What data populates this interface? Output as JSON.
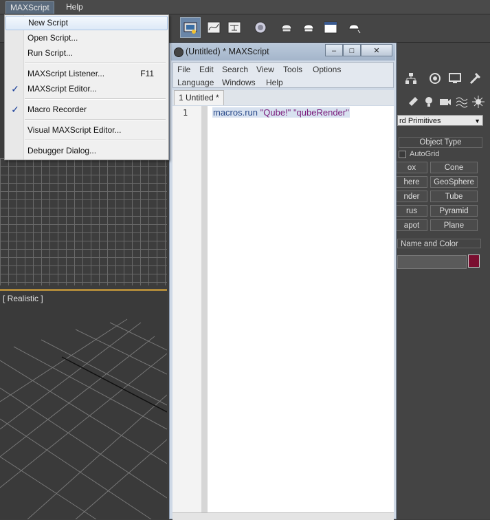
{
  "menubar": {
    "items": [
      "MAXScript",
      "Help"
    ]
  },
  "dropdown": {
    "items": [
      {
        "label": "New Script",
        "shortcut": "",
        "checked": false,
        "highlighted": true
      },
      {
        "label": "Open Script...",
        "shortcut": "",
        "checked": false
      },
      {
        "label": "Run Script...",
        "shortcut": "",
        "checked": false
      },
      {
        "label": "MAXScript Listener...",
        "shortcut": "F11",
        "checked": false
      },
      {
        "label": "MAXScript Editor...",
        "shortcut": "",
        "checked": true
      },
      {
        "label": "Macro Recorder",
        "shortcut": "",
        "checked": true
      },
      {
        "label": "Visual MAXScript Editor...",
        "shortcut": "",
        "checked": false
      },
      {
        "label": "Debugger Dialog...",
        "shortcut": "",
        "checked": false
      }
    ],
    "check_glyph": "✓"
  },
  "viewport": {
    "label": "[ Realistic ]"
  },
  "editor": {
    "title": "(Untitled) * MAXScript",
    "window_buttons": {
      "minimize": "–",
      "maximize": "□",
      "close": "✕"
    },
    "menu_row1": [
      "File",
      "Edit",
      "Search",
      "View",
      "Tools",
      "Options"
    ],
    "menu_row2": [
      "Language",
      "Windows",
      "Help"
    ],
    "tab_label": "1 Untitled *",
    "line_number": "1",
    "code": {
      "fn": "macros.run",
      "arg1": "\"Qube!\"",
      "arg2": "\"qubeRender\""
    }
  },
  "command_panel": {
    "dropdown_value": "rd Primitives",
    "object_type_title": "Object Type",
    "autogrid_label": "AutoGrid",
    "primitives": [
      "ox",
      "Cone",
      "here",
      "GeoSphere",
      "nder",
      "Tube",
      "rus",
      "Pyramid",
      "apot",
      "Plane"
    ],
    "name_color_title": "Name and Color",
    "object_color": "#7a0f30"
  },
  "colors": {
    "menu_active": "#5a6a7c",
    "toolbar_active": "#6a86a8",
    "viewport_border": "#b08a3a"
  }
}
